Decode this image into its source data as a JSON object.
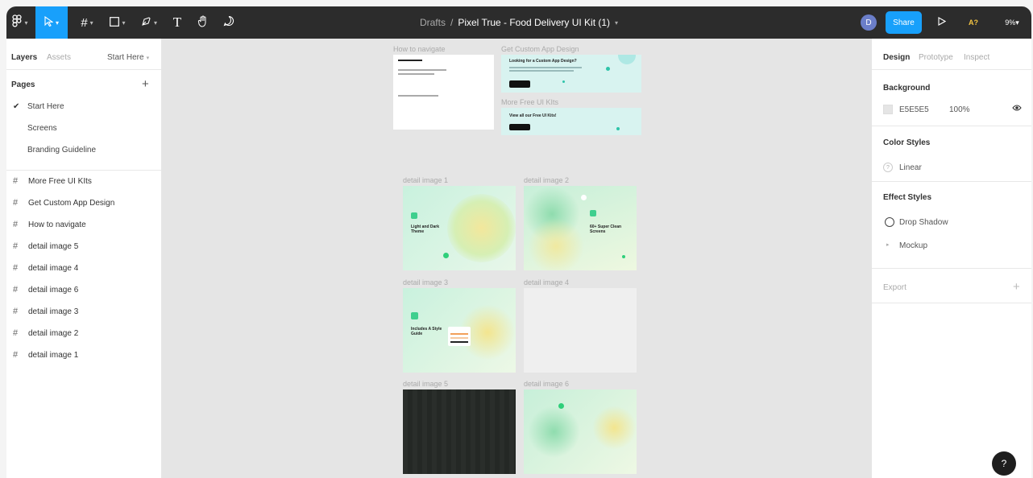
{
  "toolbar": {
    "breadcrumb": "Drafts",
    "separator": "/",
    "file_name": "Pixel True - Food Delivery UI Kit (1)",
    "avatar_letter": "D",
    "share_label": "Share",
    "a11y_label": "A?",
    "zoom": "9%",
    "text_tool": "T"
  },
  "left_panel": {
    "tabs": [
      "Layers",
      "Assets"
    ],
    "current_page": "Start Here",
    "pages_header": "Pages",
    "pages": [
      "Start Here",
      "Screens",
      "Branding Guideline"
    ],
    "layers": [
      "More Free UI KIts",
      "Get Custom App Design",
      "How to navigate",
      "detail image 5",
      "detail image 4",
      "detail image 6",
      "detail image 3",
      "detail image 2",
      "detail image 1"
    ]
  },
  "right_panel": {
    "tabs": [
      "Design",
      "Prototype",
      "Inspect"
    ],
    "background_title": "Background",
    "background_hex": "E5E5E5",
    "background_opacity": "100%",
    "color_styles_title": "Color Styles",
    "color_style": "Linear",
    "effect_styles_title": "Effect Styles",
    "effect_style": "Drop Shadow",
    "effect_group": "Mockup",
    "export_title": "Export",
    "help": "?"
  },
  "canvas": {
    "frames": {
      "how_to": "How to navigate",
      "custom": "Get Custom App Design",
      "more": "More Free UI KIts",
      "d1": "detail image 1",
      "d2": "detail image 2",
      "d3": "detail image 3",
      "d4": "detail image 4",
      "d5": "detail image 5",
      "d6": "detail image 6"
    },
    "custom_heading": "Looking for a Custom App Design?",
    "more_heading": "View all our Free UI Kits!",
    "d1_text": "Light and Dark Theme",
    "d2_text": "60+ Super Clean Screens",
    "d3_text": "Includes A Style Guide"
  },
  "colors": {
    "accent": "#18a0fb",
    "toolbar_bg": "#2c2c2c",
    "canvas_bg": "#e5e5e5"
  }
}
